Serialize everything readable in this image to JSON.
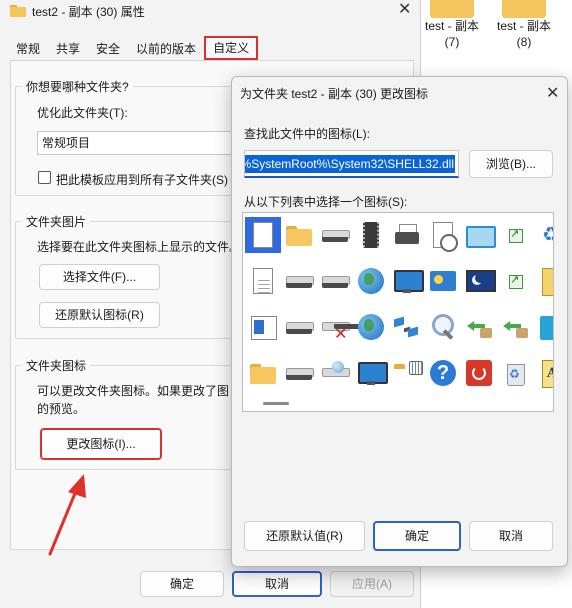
{
  "background_explorer": {
    "files": [
      {
        "name_line1": "test - 副本",
        "name_line2": "(7)"
      },
      {
        "name_line1": "test - 副本",
        "name_line2": "(8)"
      }
    ]
  },
  "properties": {
    "title": "test2 - 副本 (30) 属性",
    "tabs": [
      {
        "label": "常规"
      },
      {
        "label": "共享"
      },
      {
        "label": "安全"
      },
      {
        "label": "以前的版本"
      },
      {
        "label": "自定义",
        "active": true
      }
    ],
    "folder_type_group": {
      "legend": "你想要哪种文件夹?",
      "optimize_label": "优化此文件夹(T):",
      "optimize_value": "常规项目",
      "apply_template_label": "把此模板应用到所有子文件夹(S)"
    },
    "folder_picture_group": {
      "legend": "文件夹图片",
      "description": "选择要在此文件夹图标上显示的文件。",
      "choose_file_button": "选择文件(F)...",
      "restore_default_button": "还原默认图标(R)"
    },
    "folder_icon_group": {
      "legend": "文件夹图标",
      "description_line1": "可以更改文件夹图标。如果更改了图",
      "description_line2": "的预览。",
      "change_icon_button": "更改图标(I)..."
    },
    "footer": {
      "ok_button": "确定",
      "cancel_button": "取消",
      "apply_button": "应用(A)"
    }
  },
  "change_icon_dialog": {
    "title": "为文件夹 test2 - 副本 (30) 更改图标",
    "find_label": "查找此文件中的图标(L):",
    "path_value": "%SystemRoot%\\System32\\SHELL32.dll",
    "browse_button": "浏览(B)...",
    "list_label": "从以下列表中选择一个图标(S):",
    "icons": [
      [
        "blank-document-icon",
        "folder-icon",
        "drive-icon",
        "memory-chip-icon",
        "printer-icon",
        "document-clock-icon",
        "window-icon",
        "shortcut-icon",
        "recycle-icon"
      ],
      [
        "text-document-icon",
        "drive-icon",
        "drive-green-icon",
        "globe-icon",
        "monitor-globe-icon",
        "control-panel-icon",
        "monitor-moon-icon",
        "shortcut-arrow-icon",
        "document-yellow-icon"
      ],
      [
        "blue-document-icon",
        "drive-icon",
        "drive-error-icon",
        "network-globe-icon",
        "network-icon",
        "search-icon",
        "move-icon",
        "box-icon",
        "cyan-square-icon"
      ],
      [
        "folder-icon",
        "drive-icon",
        "network-drive-icon",
        "monitor-icon",
        "grid-folder-icon",
        "help-icon",
        "power-icon",
        "recycle-bin-icon",
        "font-icon"
      ]
    ],
    "restore_default_button": "还原默认值(R)",
    "ok_button": "确定",
    "cancel_button": "取消"
  }
}
